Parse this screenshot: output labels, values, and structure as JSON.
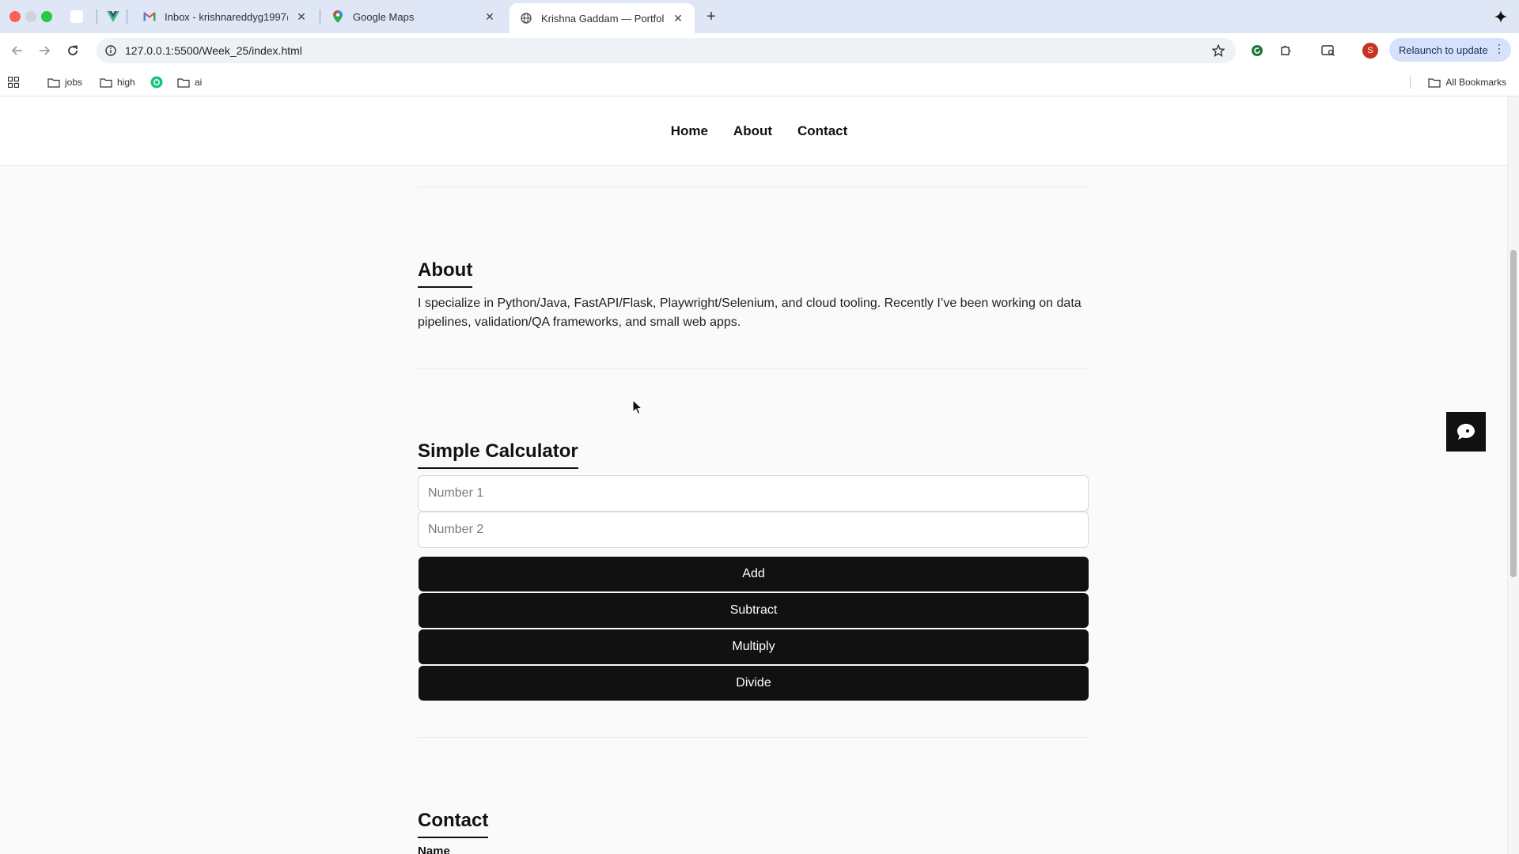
{
  "browser": {
    "tabs": [
      {
        "title": "Inbox - krishnareddyg1997@gmail.com",
        "icon": "gmail-icon"
      },
      {
        "title": "Google Maps",
        "icon": "maps-icon"
      },
      {
        "title": "Krishna Gaddam — Portfolio",
        "icon": "globe-icon",
        "active": true
      }
    ],
    "url": "127.0.0.1:5500/Week_25/index.html",
    "avatar_letter": "S",
    "relaunch_label": "Relaunch to update",
    "bookmarks": [
      "jobs",
      "high",
      "ai"
    ],
    "all_bookmarks": "All Bookmarks"
  },
  "site": {
    "nav": [
      "Home",
      "About",
      "Contact"
    ],
    "about": {
      "title": "About",
      "text": "I specialize in Python/Java, FastAPI/Flask, Playwright/Selenium, and cloud tooling. Recently I’ve been working on data pipelines, validation/QA frameworks, and small web apps."
    },
    "calculator": {
      "title": "Simple Calculator",
      "placeholder_1": "Number 1",
      "placeholder_2": "Number 2",
      "buttons": [
        "Add",
        "Subtract",
        "Multiply",
        "Divide"
      ]
    },
    "contact": {
      "title": "Contact",
      "name_label": "Name"
    }
  },
  "colors": {
    "tabbar": "#dfe6f5",
    "button_bg": "#111111",
    "page_bg": "#fafafa",
    "relaunch_bg": "#d6e2fb"
  }
}
